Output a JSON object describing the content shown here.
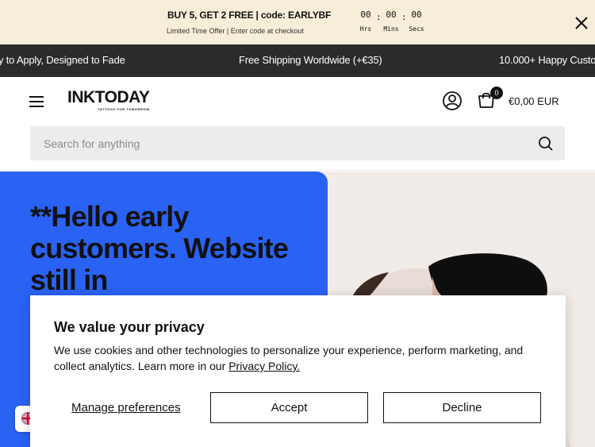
{
  "promo": {
    "title": "BUY 5, GET 2 FREE | code: EARLYBF",
    "subtitle": "Limited Time Offer | Enter code at checkout",
    "timer": {
      "hours": "00",
      "minutes": "00",
      "seconds": "00",
      "hours_label": "Hrs",
      "minutes_label": "Mins",
      "seconds_label": "Secs",
      "separator": ":"
    }
  },
  "marquee": {
    "items": [
      "y to Apply, Designed to Fade",
      "Free Shipping Worldwide (+€35)",
      "10.000+ Happy Custo"
    ]
  },
  "header": {
    "logo": "INKTODAY",
    "tagline": "TATTOOS FOR TOMORROW.",
    "cart_count": "0",
    "cart_total": "€0,00 EUR",
    "search_placeholder": "Search for anything"
  },
  "hero": {
    "headline": "**Hello early customers. Website still in"
  },
  "cookie": {
    "title": "We value your privacy",
    "body": "We use cookies and other technologies to personalize your experience, perform marketing, and collect analytics. Learn more in our",
    "link": "Privacy Policy.",
    "manage": "Manage preferences",
    "accept": "Accept",
    "decline": "Decline"
  },
  "colors": {
    "promo_bg": "#f6eed9",
    "marquee_bg": "#2b2b2b",
    "hero_blue": "#2a62f4",
    "hero_bg": "#f1ece8"
  },
  "icons": [
    "close-icon",
    "hamburger-icon",
    "account-icon",
    "cart-icon",
    "search-icon",
    "uk-flag-icon"
  ]
}
